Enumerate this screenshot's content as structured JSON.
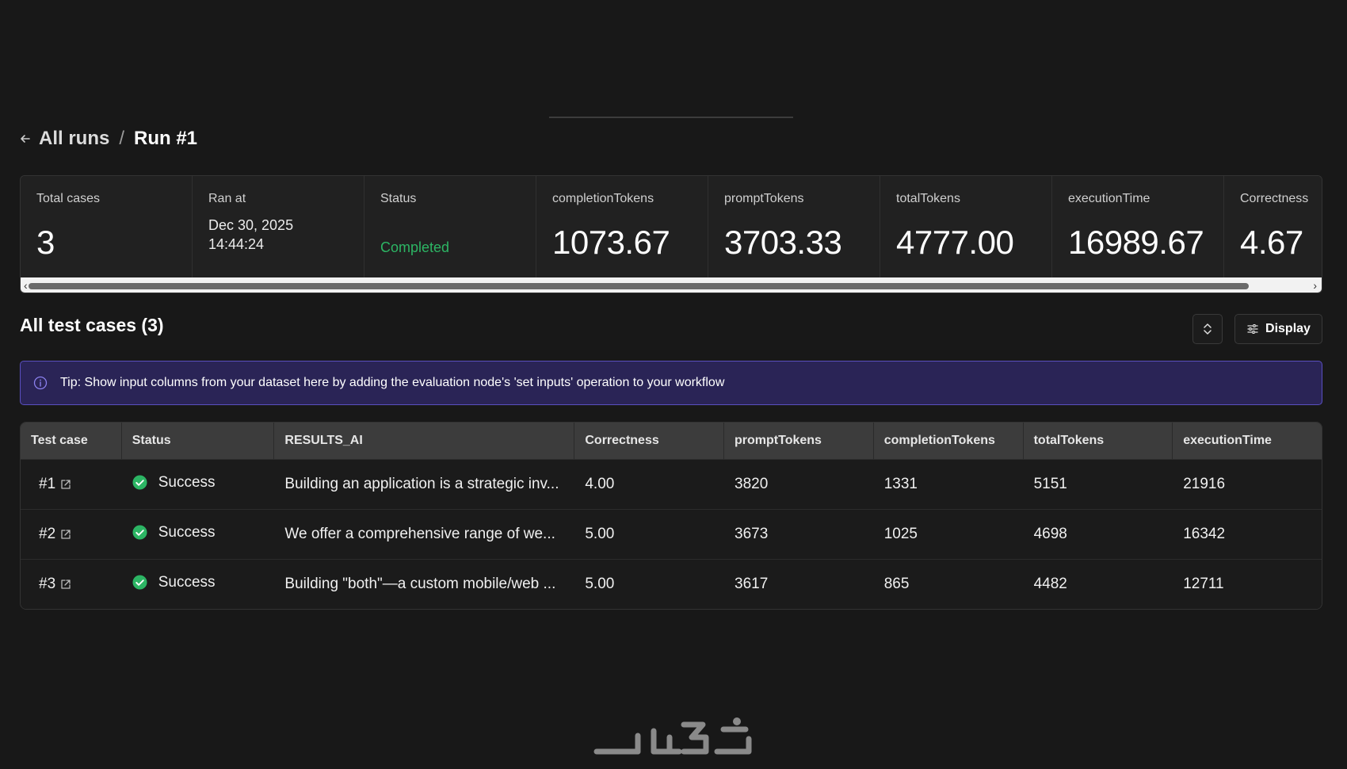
{
  "breadcrumb": {
    "parent": "All runs",
    "separator": "/",
    "current": "Run #1"
  },
  "stats": [
    {
      "label": "Total cases",
      "value": "3"
    },
    {
      "label": "Ran at",
      "date": "Dec 30, 2025",
      "time": "14:44:24"
    },
    {
      "label": "Status",
      "status": "Completed"
    },
    {
      "label": "completionTokens",
      "value": "1073.67"
    },
    {
      "label": "promptTokens",
      "value": "3703.33"
    },
    {
      "label": "totalTokens",
      "value": "4777.00"
    },
    {
      "label": "executionTime",
      "value": "16989.67"
    },
    {
      "label": "Correctness",
      "value": "4.67"
    }
  ],
  "scrollbar": {
    "left_arrow": "‹",
    "right_arrow": "›"
  },
  "section": {
    "title": "All test cases (3)",
    "display_label": "Display"
  },
  "tip": {
    "text": "Tip: Show input columns from your dataset here by adding the evaluation node's 'set inputs' operation to your workflow"
  },
  "table": {
    "columns": [
      "Test case",
      "Status",
      "RESULTS_AI",
      "Correctness",
      "promptTokens",
      "completionTokens",
      "totalTokens",
      "executionTime"
    ],
    "rows": [
      {
        "case": "#1",
        "status": "Success",
        "result": "Building an application is a strategic inv...",
        "correctness": "4.00",
        "promptTokens": "3820",
        "completionTokens": "1331",
        "totalTokens": "5151",
        "executionTime": "21916"
      },
      {
        "case": "#2",
        "status": "Success",
        "result": "We offer a comprehensive range of we...",
        "correctness": "5.00",
        "promptTokens": "3673",
        "completionTokens": "1025",
        "totalTokens": "4698",
        "executionTime": "16342"
      },
      {
        "case": "#3",
        "status": "Success",
        "result": "Building \"both\"—a custom mobile/web ...",
        "correctness": "5.00",
        "promptTokens": "3617",
        "completionTokens": "865",
        "totalTokens": "4482",
        "executionTime": "12711"
      }
    ]
  },
  "colors": {
    "background": "#181818",
    "success": "#2cb564",
    "tip_background": "#2a2456",
    "tip_border": "#5a4fc0"
  }
}
